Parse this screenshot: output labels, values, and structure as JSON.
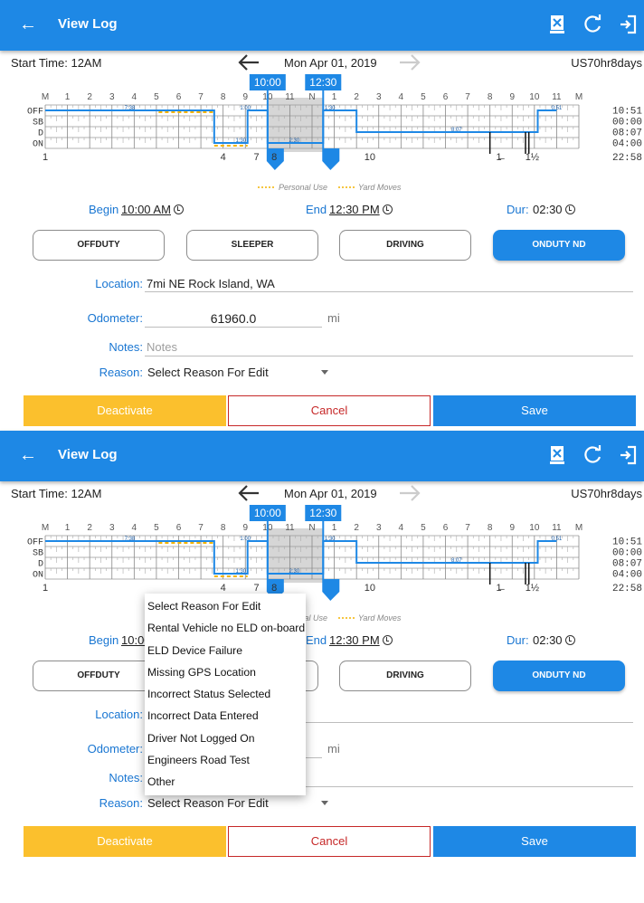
{
  "appbar": {
    "title": "View Log",
    "icons": [
      "back-arrow-icon",
      "delete-log-icon",
      "refresh-icon",
      "logout-icon"
    ],
    "color": "#1e88e5"
  },
  "log_header": {
    "start_time": "Start Time: 12AM",
    "date": "Mon Apr 01, 2019",
    "ruleset": "US70hr8days"
  },
  "graph": {
    "hour_labels": [
      "M",
      "1",
      "2",
      "3",
      "4",
      "5",
      "6",
      "7",
      "8",
      "9",
      "10",
      "11",
      "N",
      "1",
      "2",
      "3",
      "4",
      "5",
      "6",
      "7",
      "8",
      "9",
      "10",
      "11",
      "M"
    ],
    "row_labels": [
      "OFF",
      "SB",
      "D",
      "ON"
    ],
    "totals": [
      "10:51",
      "00:00",
      "08:07",
      "04:00"
    ],
    "grand_total": "22:58",
    "handle_start": "10:00",
    "handle_end": "12:30",
    "bottom_markers": [
      {
        "label": "1",
        "hour": 0
      },
      {
        "label": "4",
        "hour": 8
      },
      {
        "label": "7",
        "hour": 9.5
      },
      {
        "label": "8",
        "hour": 10.3
      },
      {
        "label": "10",
        "hour": 14.6
      },
      {
        "label": "1̶",
        "hour": 20.4
      },
      {
        "label": "1½",
        "hour": 21.9
      }
    ],
    "duration_labels": [
      {
        "text": "7:38",
        "hour": 3.8,
        "row": 0
      },
      {
        "text": "1:00",
        "hour": 9.0,
        "row": 0
      },
      {
        "text": "1:30",
        "hour": 12.8,
        "row": 0
      },
      {
        "text": "0:51",
        "hour": 23.0,
        "row": 0
      },
      {
        "text": "1:30",
        "hour": 8.8,
        "row": 3
      },
      {
        "text": "2:30",
        "hour": 11.2,
        "row": 3
      },
      {
        "text": "8:07",
        "hour": 18.5,
        "row": 2
      }
    ],
    "status_timeline": [
      {
        "from": 0,
        "to": 7.6,
        "row": 0
      },
      {
        "from": 7.6,
        "to": 9.1,
        "row": 3
      },
      {
        "from": 9.1,
        "to": 10.0,
        "row": 0
      },
      {
        "from": 10.0,
        "to": 12.5,
        "row": 3
      },
      {
        "from": 12.5,
        "to": 14.0,
        "row": 0
      },
      {
        "from": 14.0,
        "to": 22.15,
        "row": 2
      },
      {
        "from": 22.15,
        "to": 23.0,
        "row": 0
      }
    ],
    "personal_use_segment": {
      "from": 5.1,
      "to": 7.6
    },
    "yard_move_segment": {
      "from": 7.6,
      "to": 9.1
    },
    "legend": {
      "personal_use": "Personal Use",
      "yard_moves": "Yard Moves"
    },
    "colors": {
      "line": "#1e88e5",
      "handle": "#1e88e5",
      "personal": "#f4b400",
      "yard": "#f4b400",
      "selection": "#d6d6d6"
    }
  },
  "edit_times": {
    "begin_label": "Begin",
    "begin_value": "10:00 AM",
    "end_label": "End",
    "end_value": "12:30 PM",
    "dur_label": "Dur:",
    "dur_value": "02:30"
  },
  "status_buttons": [
    {
      "label": "OFFDUTY",
      "active": false
    },
    {
      "label": "SLEEPER",
      "active": false
    },
    {
      "label": "DRIVING",
      "active": false
    },
    {
      "label": "ONDUTY ND",
      "active": true
    }
  ],
  "form": {
    "location_label": "Location:",
    "location_value": "7mi NE Rock Island, WA",
    "odometer_label": "Odometer:",
    "odometer_value": "61960.0",
    "odometer_unit": "mi",
    "notes_label": "Notes:",
    "notes_placeholder": "Notes",
    "reason_label": "Reason:",
    "reason_value": "Select Reason For Edit"
  },
  "actions": {
    "deactivate": "Deactivate",
    "cancel": "Cancel",
    "save": "Save"
  },
  "reason_options": [
    "Select Reason For Edit",
    "Rental Vehicle no ELD on-board",
    "ELD Device Failure",
    "Missing GPS Location",
    "Incorrect Status Selected",
    "Incorrect Data Entered",
    "Driver Not Logged On",
    "Engineers Road Test",
    "Other"
  ]
}
